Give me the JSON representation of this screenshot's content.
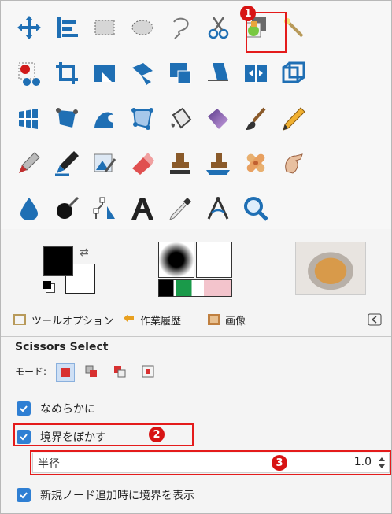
{
  "tools": [
    {
      "name": "move-tool-icon"
    },
    {
      "name": "align-tool-icon"
    },
    {
      "name": "rect-select-tool-icon"
    },
    {
      "name": "ellipse-select-tool-icon"
    },
    {
      "name": "free-select-tool-icon"
    },
    {
      "name": "scissors-select-tool-icon"
    },
    {
      "name": "fuzzy-select-tool-icon"
    },
    {
      "name": "magic-wand-tool-icon"
    },
    {
      "name": "foreground-select-tool-icon"
    },
    {
      "name": "crop-tool-icon"
    },
    {
      "name": "unified-transform-tool-icon"
    },
    {
      "name": "rotate-tool-icon"
    },
    {
      "name": "scale-tool-icon"
    },
    {
      "name": "shear-tool-icon"
    },
    {
      "name": "flip-tool-icon"
    },
    {
      "name": "perspective-tool-icon"
    },
    {
      "name": "grid-transform-tool-icon"
    },
    {
      "name": "warp-tool-icon"
    },
    {
      "name": "wave-tool-icon"
    },
    {
      "name": "cage-tool-icon"
    },
    {
      "name": "bucket-fill-tool-icon"
    },
    {
      "name": "gradient-tool-icon"
    },
    {
      "name": "paintbrush-tool-icon"
    },
    {
      "name": "pencil-tool-icon"
    },
    {
      "name": "airbrush-tool-icon"
    },
    {
      "name": "ink-tool-icon"
    },
    {
      "name": "mypaint-brush-tool-icon"
    },
    {
      "name": "eraser-tool-icon"
    },
    {
      "name": "clone-tool-icon"
    },
    {
      "name": "perspective-clone-tool-icon"
    },
    {
      "name": "heal-tool-icon"
    },
    {
      "name": "smudge-tool-icon"
    },
    {
      "name": "blur-tool-icon"
    },
    {
      "name": "dodge-burn-tool-icon"
    },
    {
      "name": "paths-tool-icon"
    },
    {
      "name": "text-tool-icon"
    },
    {
      "name": "color-picker-tool-icon"
    },
    {
      "name": "measure-tool-icon"
    },
    {
      "name": "zoom-tool-icon"
    }
  ],
  "tabs": [
    {
      "label": "ツールオプション"
    },
    {
      "label": "作業履歴"
    },
    {
      "label": "画像"
    }
  ],
  "options": {
    "title": "Scissors Select",
    "mode_label": "モード:",
    "checkboxes": [
      {
        "label": "なめらかに",
        "checked": true
      },
      {
        "label": "境界をぼかす",
        "checked": true
      },
      {
        "label": "新規ノード追加時に境界を表示",
        "checked": true
      }
    ],
    "radius": {
      "label": "半径",
      "value": "1.0"
    }
  },
  "callouts": [
    "1",
    "2",
    "3"
  ],
  "colors": {
    "accent": "#2f7fd3",
    "callout": "#e41b1b",
    "tool_blue": "#1f6fb4"
  }
}
